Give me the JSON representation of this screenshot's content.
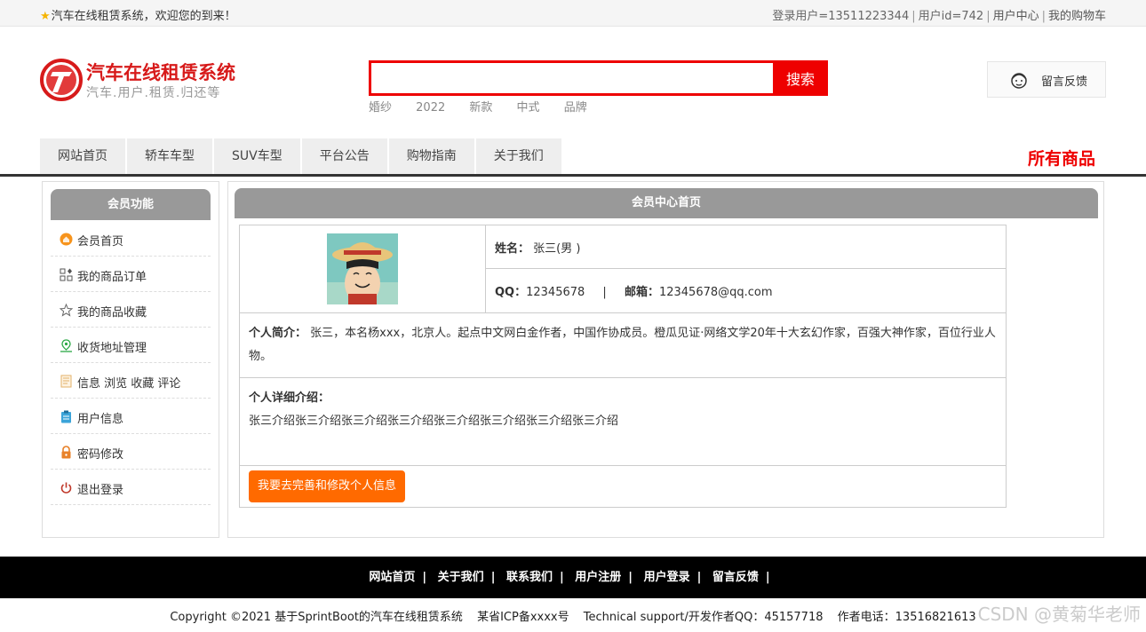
{
  "topbar": {
    "welcome": "汽车在线租赁系统，欢迎您的到来！",
    "login_user": "登录用户=13511223344",
    "user_id": "用户id=742",
    "user_center": "用户中心",
    "cart": "我的购物车"
  },
  "header": {
    "logo_title": "汽车在线租赁系统",
    "logo_sub": "汽车.用户.租赁.归还等",
    "search_placeholder": "",
    "search_button": "搜索",
    "hotwords": [
      "婚纱",
      "2022",
      "新款",
      "中式",
      "品牌"
    ],
    "feedback": "留言反馈"
  },
  "nav": {
    "items": [
      "网站首页",
      "轿车车型",
      "SUV车型",
      "平台公告",
      "购物指南",
      "关于我们"
    ],
    "all_goods": "所有商品"
  },
  "sidebar": {
    "title": "会员功能",
    "items": [
      {
        "label": "会员首页",
        "icon": "home-icon"
      },
      {
        "label": "我的商品订单",
        "icon": "order-icon"
      },
      {
        "label": "我的商品收藏",
        "icon": "star-icon"
      },
      {
        "label": "收货地址管理",
        "icon": "location-icon"
      },
      {
        "label": "信息 浏览 收藏 评论",
        "icon": "document-icon"
      },
      {
        "label": "用户信息",
        "icon": "clipboard-icon"
      },
      {
        "label": "密码修改",
        "icon": "lock-icon"
      },
      {
        "label": "退出登录",
        "icon": "power-icon"
      }
    ]
  },
  "main": {
    "title": "会员中心首页",
    "name_label": "姓名：",
    "name_value": "张三(男 )",
    "qq_label": "QQ：",
    "qq_value": "12345678",
    "divider": "|",
    "email_label": "邮箱：",
    "email_value": "12345678@qq.com",
    "intro_label": "个人简介：",
    "intro_value": "张三，本名杨xxx，北京人。起点中文网白金作者，中国作协成员。橙瓜见证·网络文学20年十大玄幻作家，百强大神作家，百位行业人物。",
    "detail_label": "个人详细介绍：",
    "detail_value": "张三介绍张三介绍张三介绍张三介绍张三介绍张三介绍张三介绍张三介绍",
    "edit_button": "我要去完善和修改个人信息"
  },
  "footer": {
    "links": [
      "网站首页",
      "关于我们",
      "联系我们",
      "用户注册",
      "用户登录",
      "留言反馈"
    ],
    "separator": "|",
    "copyright": "Copyright ©2021 基于SprintBoot的汽车在线租赁系统",
    "icp": "某省ICP备xxxx号",
    "support": "Technical support/开发作者QQ：45157718",
    "phone": "作者电话：13516821613",
    "watermark": "CSDN @黄菊华老师"
  },
  "colors": {
    "accent_red": "#ee0000",
    "button_orange": "#ff6a00",
    "panel_gray": "#999999"
  }
}
